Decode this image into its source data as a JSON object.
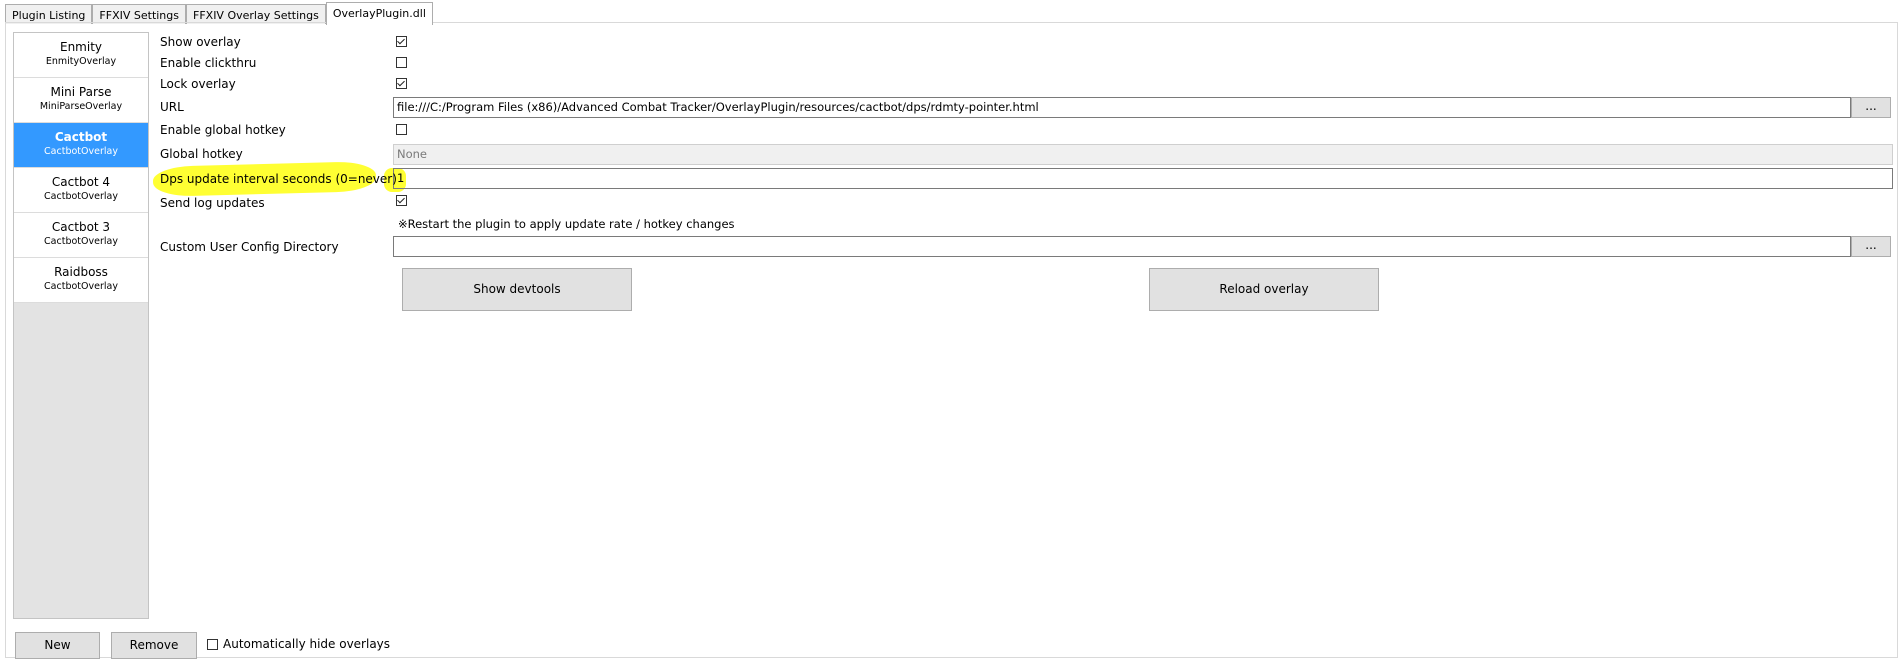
{
  "tabs": [
    {
      "label": "Plugin Listing"
    },
    {
      "label": "FFXIV Settings"
    },
    {
      "label": "FFXIV Overlay Settings"
    },
    {
      "label": "OverlayPlugin.dll"
    }
  ],
  "overlays": [
    {
      "name": "Enmity",
      "type": "EnmityOverlay"
    },
    {
      "name": "Mini Parse",
      "type": "MiniParseOverlay"
    },
    {
      "name": "Cactbot",
      "type": "CactbotOverlay"
    },
    {
      "name": "Cactbot 4",
      "type": "CactbotOverlay"
    },
    {
      "name": "Cactbot 3",
      "type": "CactbotOverlay"
    },
    {
      "name": "Raidboss",
      "type": "CactbotOverlay"
    }
  ],
  "settings": {
    "show_overlay": {
      "label": "Show overlay",
      "checked": true
    },
    "enable_clickthru": {
      "label": "Enable clickthru",
      "checked": false
    },
    "lock_overlay": {
      "label": "Lock overlay",
      "checked": true
    },
    "url": {
      "label": "URL",
      "value": "file:///C:/Program Files (x86)/Advanced Combat Tracker/OverlayPlugin/resources/cactbot/dps/rdmty-pointer.html"
    },
    "enable_global_hotkey": {
      "label": "Enable global hotkey",
      "checked": false
    },
    "global_hotkey": {
      "label": "Global hotkey",
      "value": "None"
    },
    "dps_interval": {
      "label": "Dps update interval seconds (0=never)",
      "value": "1"
    },
    "send_log_updates": {
      "label": "Send log updates",
      "checked": true
    },
    "restart_note": "※Restart the plugin to apply update rate / hotkey changes",
    "custom_config_dir": {
      "label": "Custom User Config Directory",
      "value": ""
    },
    "browse_label": "..."
  },
  "buttons": {
    "show_devtools": "Show devtools",
    "reload_overlay": "Reload overlay",
    "new": "New",
    "remove": "Remove"
  },
  "auto_hide": {
    "label": "Automatically hide overlays",
    "checked": false
  },
  "colors": {
    "selected": "#3399ff",
    "highlight": "#ffff33"
  }
}
